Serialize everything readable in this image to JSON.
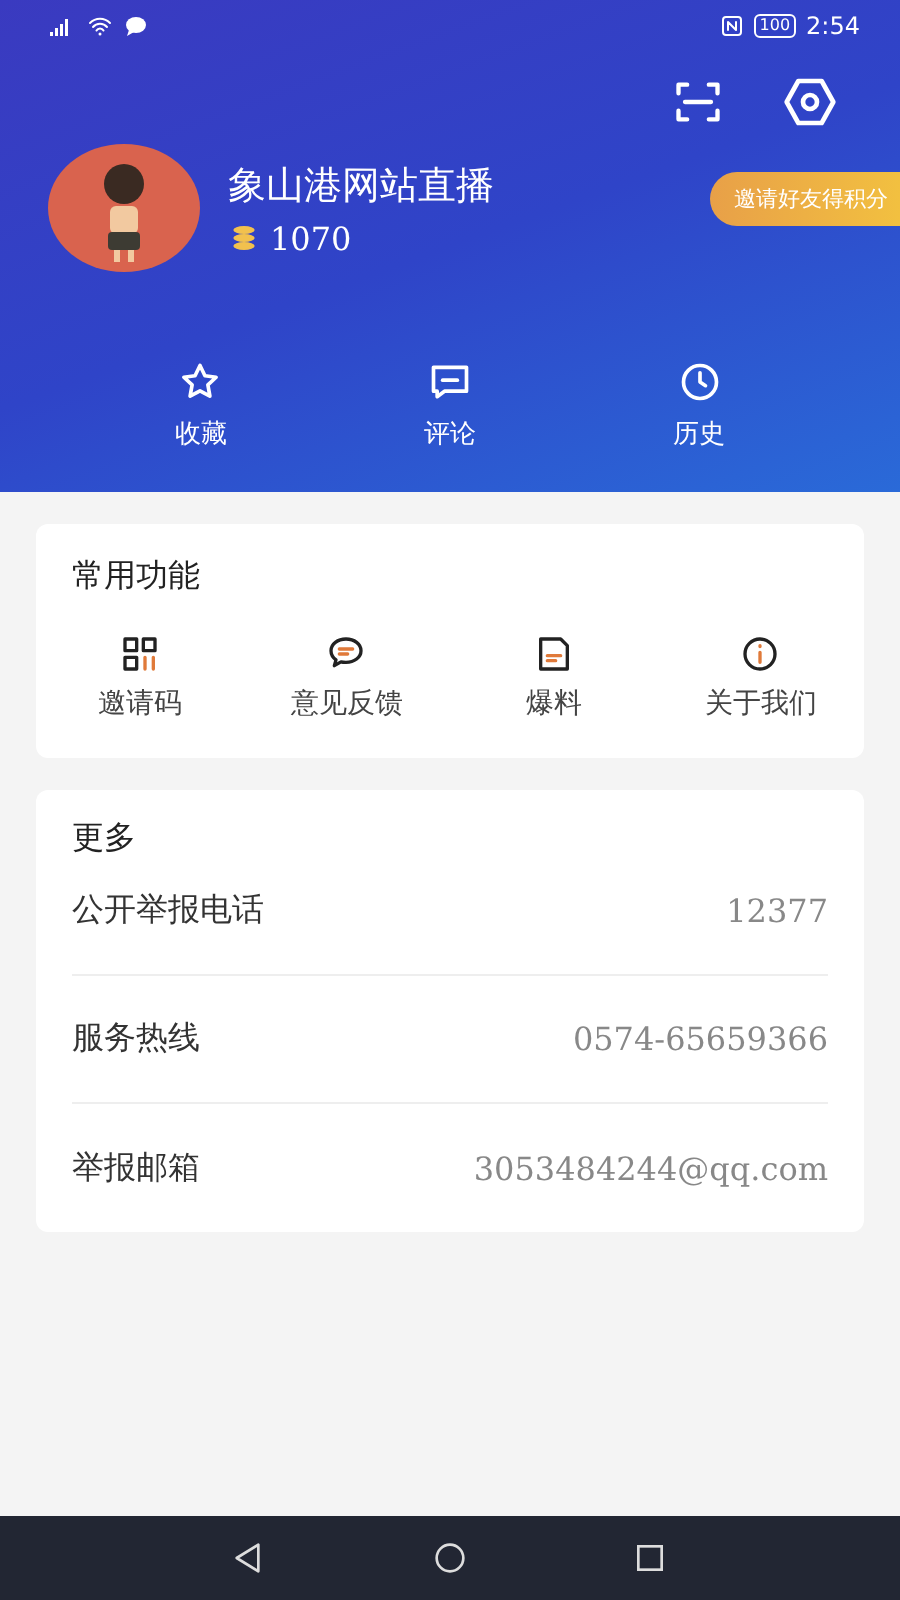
{
  "status_bar": {
    "battery": "100",
    "time": "2:54"
  },
  "profile": {
    "name": "象山港网站直播",
    "points": "1070",
    "invite_badge": "邀请好友得积分"
  },
  "quick_tabs": [
    {
      "kind": "star",
      "label": "收藏"
    },
    {
      "kind": "comment",
      "label": "评论"
    },
    {
      "kind": "clock",
      "label": "历史"
    }
  ],
  "functions": {
    "title": "常用功能",
    "items": [
      {
        "kind": "qr",
        "label": "邀请码"
      },
      {
        "kind": "chat",
        "label": "意见反馈"
      },
      {
        "kind": "note",
        "label": "爆料"
      },
      {
        "kind": "info",
        "label": "关于我们"
      }
    ]
  },
  "more": {
    "title": "更多",
    "rows": [
      {
        "label": "公开举报电话",
        "value": "12377"
      },
      {
        "label": "服务热线",
        "value": "0574-65659366"
      },
      {
        "label": "举报邮箱",
        "value": "3053484244@qq.com"
      }
    ]
  }
}
